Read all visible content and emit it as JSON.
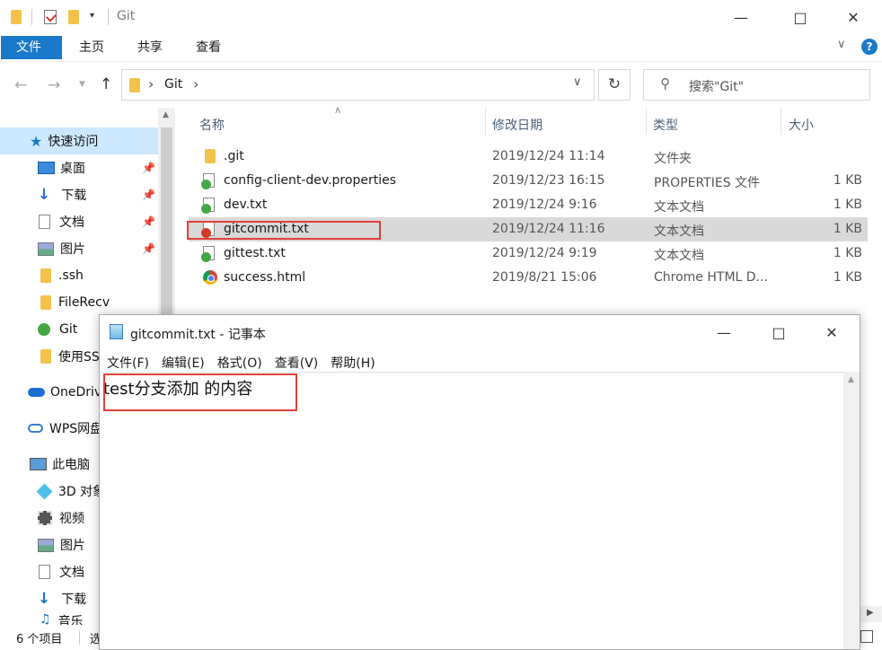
{
  "titlebar": {
    "title": "Git"
  },
  "ribbon": {
    "tabs": [
      "文件",
      "主页",
      "共享",
      "查看"
    ],
    "help": "?"
  },
  "address": {
    "path_segment": "Git",
    "separator": "›",
    "search_placeholder": "搜索\"Git\""
  },
  "columns": {
    "name": "名称",
    "date": "修改日期",
    "type": "类型",
    "size": "大小"
  },
  "files": [
    {
      "name": ".git",
      "date": "2019/12/24 11:14",
      "type": "文件夹",
      "size": ""
    },
    {
      "name": "config-client-dev.properties",
      "date": "2019/12/23 16:15",
      "type": "PROPERTIES 文件",
      "size": "1 KB"
    },
    {
      "name": "dev.txt",
      "date": "2019/12/24 9:16",
      "type": "文本文档",
      "size": "1 KB"
    },
    {
      "name": "gitcommit.txt",
      "date": "2019/12/24 11:16",
      "type": "文本文档",
      "size": "1 KB"
    },
    {
      "name": "gittest.txt",
      "date": "2019/12/24 9:19",
      "type": "文本文档",
      "size": "1 KB"
    },
    {
      "name": "success.html",
      "date": "2019/8/21 15:06",
      "type": "Chrome HTML D...",
      "size": "1 KB"
    }
  ],
  "sidebar": {
    "quick_access": "快速访问",
    "items": [
      "桌面",
      "下载",
      "文档",
      "图片",
      ".ssh",
      "FileRecv",
      "Git",
      "使用SS"
    ],
    "onedrive": "OneDriv",
    "wps": "WPS网盘",
    "this_pc": "此电脑",
    "pc_items": [
      "3D 对象",
      "视频",
      "图片",
      "文档",
      "下载",
      "音乐"
    ]
  },
  "status": {
    "count": "6 个项目",
    "selected": "选"
  },
  "notepad": {
    "title": "gitcommit.txt - 记事本",
    "menu": [
      "文件(F)",
      "编辑(E)",
      "格式(O)",
      "查看(V)",
      "帮助(H)"
    ],
    "content": "test分支添加 的内容"
  }
}
